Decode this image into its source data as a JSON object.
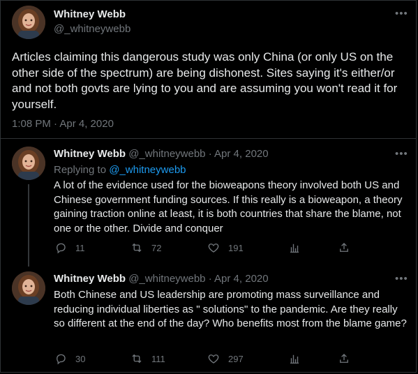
{
  "header": {
    "author_name": "Whitney Webb",
    "author_handle": "@_whitneywebb",
    "more_glyph": "•••"
  },
  "main_tweet": {
    "text": "Articles claiming this dangerous study was only China (or only US on the other side of the spectrum) are being dishonest. Sites saying it's either/or and not both govts are lying to you and are assuming you won't read it for yourself.",
    "timestamp": "1:08 PM · Apr 4, 2020"
  },
  "replies": [
    {
      "author_name": "Whitney Webb",
      "author_handle": "@_whitneywebb",
      "separator": "·",
      "date": "Apr 4, 2020",
      "replying_prefix": "Replying to",
      "replying_to": "@_whitneywebb",
      "text": "A lot of the evidence used for the bioweapons theory involved both US and Chinese government funding sources. If this really is a bioweapon, a theory gaining traction online at least, it is both countries that share the blame, not one or the other. Divide and conquer",
      "replies_count": "11",
      "retweets_count": "72",
      "likes_count": "191"
    },
    {
      "author_name": "Whitney Webb",
      "author_handle": "@_whitneywebb",
      "separator": "·",
      "date": "Apr 4, 2020",
      "text": "Both Chinese and US leadership are promoting mass surveillance and reducing individual liberties as \" solutions\" to the pandemic. Are they really so different at the end of the day? Who benefits most from the blame game?",
      "replies_count": "30",
      "retweets_count": "111",
      "likes_count": "297"
    }
  ],
  "icons": [
    "reply-icon",
    "retweet-icon",
    "like-icon",
    "analytics-icon",
    "share-icon",
    "more-icon"
  ],
  "colors": {
    "background": "#000000",
    "text": "#e7e9ea",
    "muted": "#71767b",
    "link": "#1d9bf0",
    "border": "#2f3336"
  }
}
